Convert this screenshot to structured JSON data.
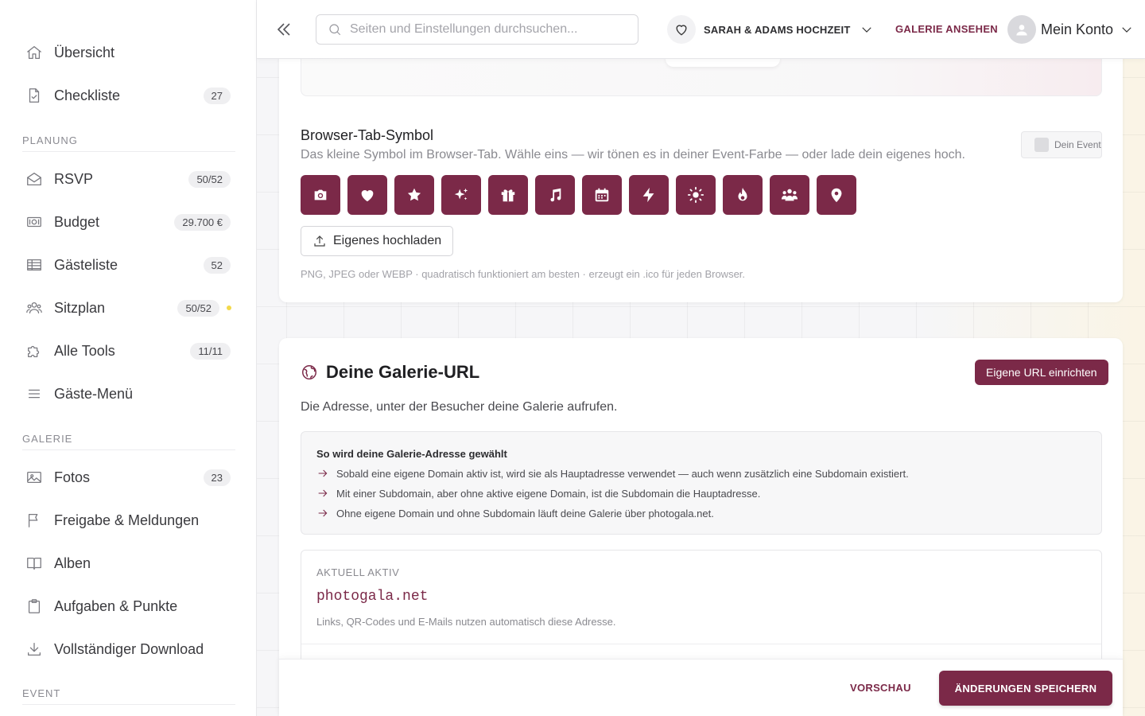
{
  "sidebar": {
    "items_top": [
      {
        "label": "Übersicht",
        "icon": "home-icon"
      },
      {
        "label": "Checkliste",
        "icon": "checklist-icon",
        "badge": "27"
      }
    ],
    "sections": [
      {
        "title": "PLANUNG"
      },
      {
        "title": "GALERIE"
      },
      {
        "title": "EVENT"
      }
    ],
    "planung": [
      {
        "label": "RSVP",
        "icon": "envelope-icon",
        "badge": "50/52"
      },
      {
        "label": "Budget",
        "icon": "money-icon",
        "badge": "29.700 €"
      },
      {
        "label": "Gästeliste",
        "icon": "table-icon",
        "badge": "52"
      },
      {
        "label": "Sitzplan",
        "icon": "people-icon",
        "badge": "50/52"
      },
      {
        "label": "Alle Tools",
        "icon": "puzzle-icon",
        "badge": "11/11"
      },
      {
        "label": "Gäste-Menü",
        "icon": "menu-icon"
      }
    ],
    "galerie": [
      {
        "label": "Fotos",
        "icon": "image-icon",
        "badge": "23"
      },
      {
        "label": "Freigabe & Meldungen",
        "icon": "flag-icon"
      },
      {
        "label": "Alben",
        "icon": "book-icon"
      },
      {
        "label": "Aufgaben & Punkte",
        "icon": "clipboard-icon"
      },
      {
        "label": "Vollständiger Download",
        "icon": "download-icon"
      }
    ]
  },
  "header": {
    "search_placeholder": "Seiten und Einstellungen durchsuchen...",
    "event_name": "SARAH & ADAMS HOCHZEIT",
    "gallery_link": "GALERIE ANSEHEN",
    "account_label": "Mein Konto"
  },
  "tab_symbol": {
    "title": "Browser-Tab-Symbol",
    "description": "Das kleine Symbol im Browser-Tab. Wähle eins — wir tönen es in deiner Event-Farbe — oder lade dein eigenes hoch.",
    "color_chip_label": "Dein Event",
    "icons": [
      "camera-icon",
      "heart-icon",
      "star-icon",
      "sparkles-icon",
      "gift-icon",
      "music-icon",
      "calendar-icon",
      "bolt-icon",
      "sun-icon",
      "flame-icon",
      "group-icon",
      "map-pin-icon"
    ],
    "upload_label": "Eigenes hochladen",
    "upload_hint": "PNG, JPEG oder WEBP · quadratisch funktioniert am besten · erzeugt ein .ico für jeden Browser."
  },
  "gallery_url": {
    "title": "Deine Galerie-URL",
    "setup_button": "Eigene URL einrichten",
    "description": "Die Adresse, unter der Besucher deine Galerie aufrufen.",
    "info_title": "So wird deine Galerie-Adresse gewählt",
    "info_lines": [
      "Sobald eine eigene Domain aktiv ist, wird sie als Hauptadresse verwendet — auch wenn zusätzlich eine Subdomain existiert.",
      "Mit einer Subdomain, aber ohne aktive eigene Domain, ist die Subdomain die Hauptadresse.",
      "Ohne eigene Domain und ohne Subdomain läuft deine Galerie über photogala.net."
    ],
    "active_label": "AKTUELL AKTIV",
    "active_url": "photogala.net",
    "active_note": "Links, QR-Codes und E-Mails nutzen automatisch diese Adresse."
  },
  "footer": {
    "preview_label": "VORSCHAU",
    "save_label": "ÄNDERUNGEN SPEICHERN"
  },
  "colors": {
    "accent": "#7b2948",
    "sitzplan_dot": "#f3d94a"
  }
}
